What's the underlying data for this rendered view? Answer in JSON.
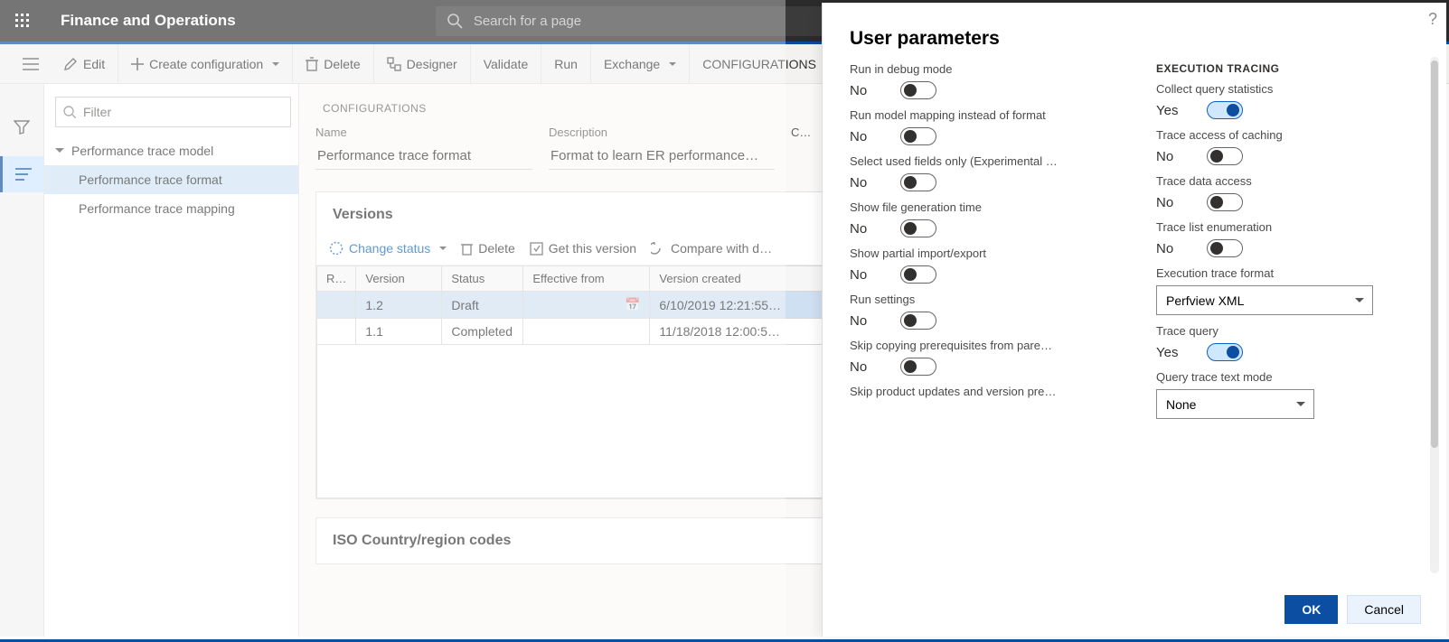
{
  "topnav": {
    "brand": "Finance and Operations",
    "search_placeholder": "Search for a page"
  },
  "cmdbar": {
    "edit": "Edit",
    "create": "Create configuration",
    "delete": "Delete",
    "designer": "Designer",
    "validate": "Validate",
    "run": "Run",
    "exchange": "Exchange",
    "configurations": "CONFIGURATIONS"
  },
  "filter_placeholder": "Filter",
  "tree": {
    "root": "Performance trace model",
    "children": [
      "Performance trace format",
      "Performance trace mapping"
    ],
    "selected_index": 0
  },
  "configs": {
    "section": "CONFIGURATIONS",
    "name_label": "Name",
    "name_value": "Performance trace format",
    "desc_label": "Description",
    "desc_value": "Format to learn ER performance…",
    "extra_label": "C…"
  },
  "versions": {
    "title": "Versions",
    "toolbar": {
      "change_status": "Change status",
      "delete": "Delete",
      "get_version": "Get this version",
      "compare": "Compare with d…"
    },
    "headers": [
      "R…",
      "Version",
      "Status",
      "Effective from",
      "Version created"
    ],
    "rows": [
      {
        "r": "",
        "version": "1.2",
        "status": "Draft",
        "effective": "",
        "created": "6/10/2019 12:21:55…"
      },
      {
        "r": "",
        "version": "1.1",
        "status": "Completed",
        "effective": "",
        "created": "11/18/2018 12:00:5…"
      }
    ],
    "selected_row": 0
  },
  "iso_card": {
    "title": "ISO Country/region codes"
  },
  "dialog": {
    "title": "User parameters",
    "left": [
      {
        "label": "Run in debug mode",
        "value": "No",
        "on": false
      },
      {
        "label": "Run model mapping instead of format",
        "value": "No",
        "on": false
      },
      {
        "label": "Select used fields only (Experimental …",
        "value": "No",
        "on": false
      },
      {
        "label": "Show file generation time",
        "value": "No",
        "on": false
      },
      {
        "label": "Show partial import/export",
        "value": "No",
        "on": false
      },
      {
        "label": "Run settings",
        "value": "No",
        "on": false
      },
      {
        "label": "Skip copying prerequisites from pare…",
        "value": "No",
        "on": false
      },
      {
        "label": "Skip product updates and version pre…",
        "value": "",
        "on": null
      }
    ],
    "right_heading": "EXECUTION TRACING",
    "right": [
      {
        "label": "Collect query statistics",
        "value": "Yes",
        "on": true
      },
      {
        "label": "Trace access of caching",
        "value": "No",
        "on": false
      },
      {
        "label": "Trace data access",
        "value": "No",
        "on": false
      },
      {
        "label": "Trace list enumeration",
        "value": "No",
        "on": false
      }
    ],
    "exec_format_label": "Execution trace format",
    "exec_format_value": "Perfview XML",
    "trace_query": {
      "label": "Trace query",
      "value": "Yes",
      "on": true
    },
    "query_mode_label": "Query trace text mode",
    "query_mode_value": "None",
    "ok": "OK",
    "cancel": "Cancel"
  }
}
